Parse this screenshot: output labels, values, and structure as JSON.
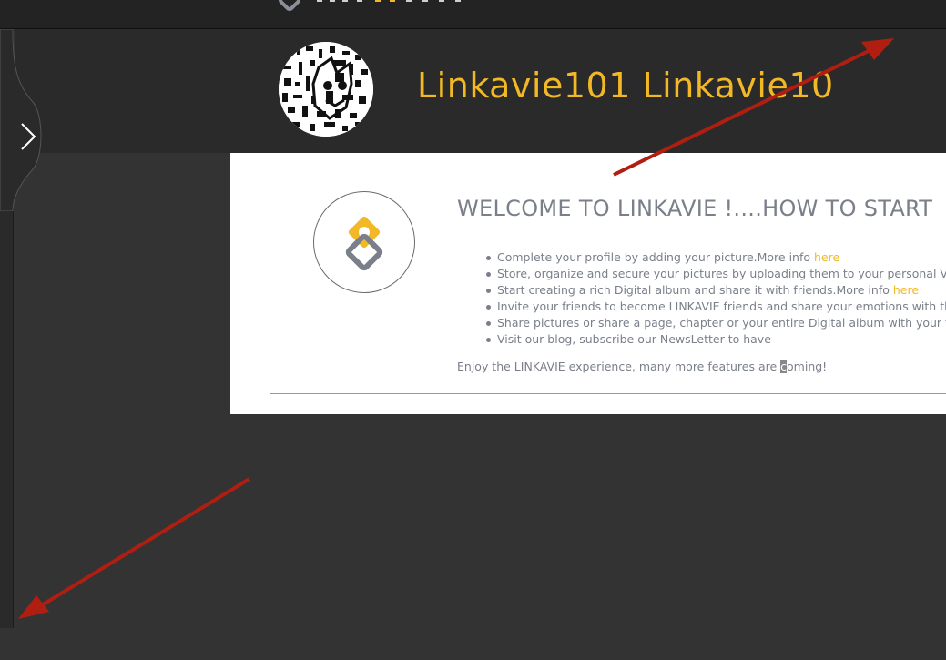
{
  "header": {
    "profile_name": "Linkavie101 Linkavie10"
  },
  "welcome": {
    "title": "WELCOME TO LINKAVIE !....HOW TO START",
    "steps": [
      {
        "text": "Complete your profile by adding your picture.More info ",
        "link": "here"
      },
      {
        "text": "Store, organize and secure your pictures by uploading them to your personal Vault."
      },
      {
        "text": "Start creating a rich Digital album and share it with friends.More info ",
        "link": "here"
      },
      {
        "text": "Invite your friends to become LINKAVIE friends and share your emotions with them"
      },
      {
        "text": "Share pictures or share a page, chapter or your entire Digital album with your friends"
      },
      {
        "text": "Visit our blog, subscribe our NewsLetter to have"
      }
    ],
    "outro_before": "Enjoy the LINKAVIE experience, many more features are ",
    "outro_selected": "c",
    "outro_after": "oming!"
  },
  "icons": {
    "sidebar_toggle": "chevron-right-icon",
    "brand": "linkavie-logo-icon",
    "avatar": "cat-avatar-image"
  },
  "colors": {
    "accent": "#f2b826",
    "background": "#333333",
    "header": "#2a2a2a",
    "text_muted": "#7a7f8a",
    "annotation_arrow": "#b01e12"
  }
}
